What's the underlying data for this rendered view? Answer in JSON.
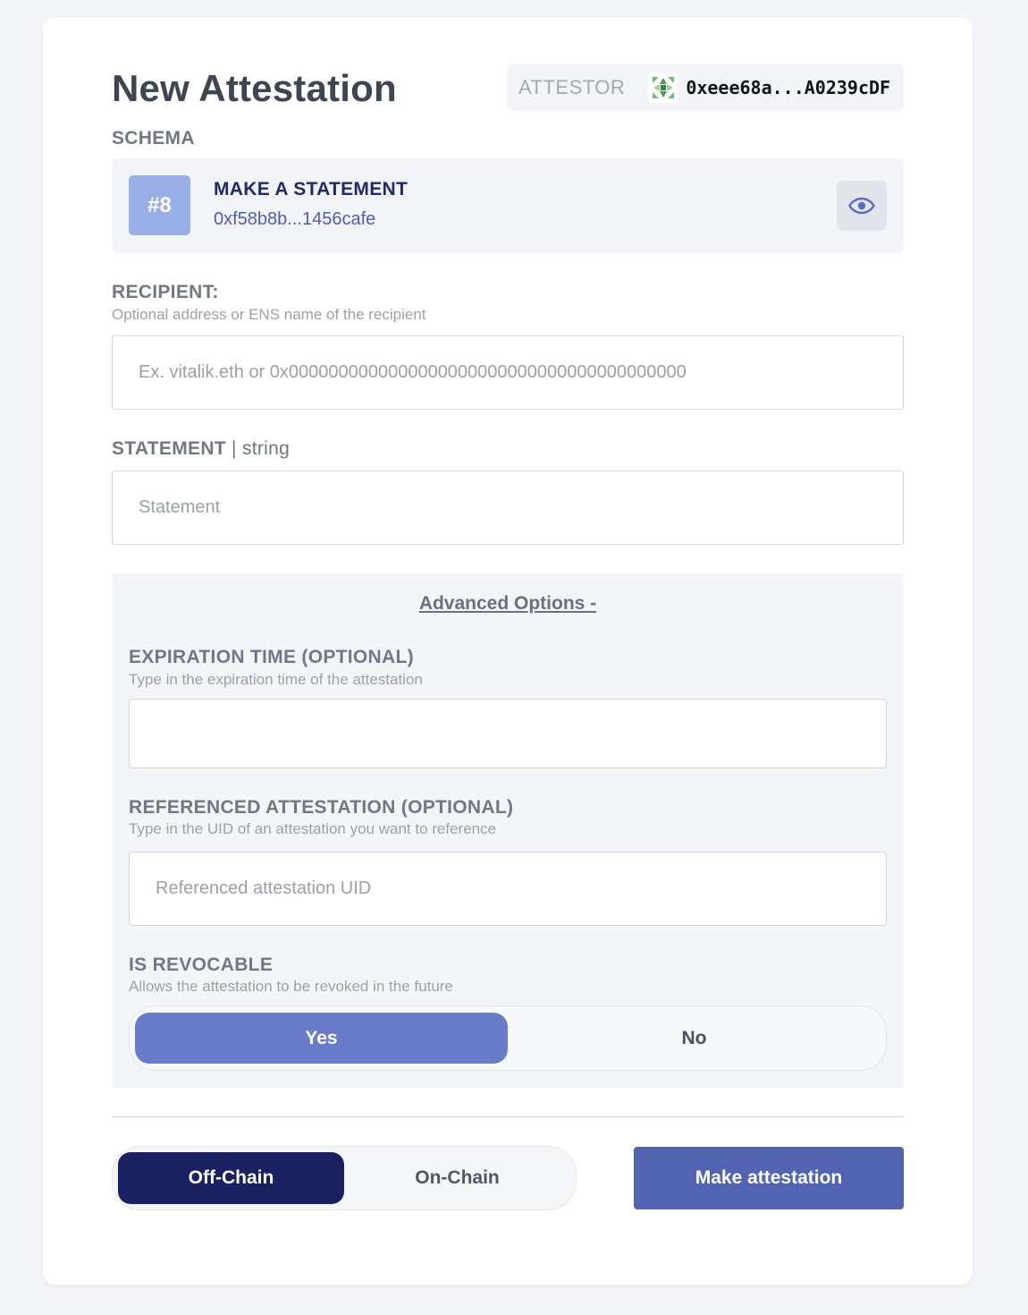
{
  "header": {
    "title": "New Attestation",
    "attestor_label": "ATTESTOR",
    "attestor_address": "0xeee68a...A0239cDF",
    "attestor_avatar_icon": "identicon-avatar"
  },
  "schema": {
    "label": "SCHEMA",
    "badge": "#8",
    "name": "MAKE A STATEMENT",
    "uid": "0xf58b8b...1456cafe",
    "view_icon": "eye-icon"
  },
  "recipient": {
    "label": "RECIPIENT:",
    "hint": "Optional address or ENS name of the recipient",
    "placeholder": "Ex. vitalik.eth or 0x0000000000000000000000000000000000000000",
    "value": ""
  },
  "statement": {
    "label": "STATEMENT",
    "type": " | string",
    "placeholder": "Statement",
    "value": ""
  },
  "advanced": {
    "toggle_label": "Advanced Options -",
    "expiration": {
      "label": "EXPIRATION TIME (OPTIONAL)",
      "hint": "Type in the expiration time of the attestation",
      "value": ""
    },
    "reference": {
      "label": "REFERENCED ATTESTATION (OPTIONAL)",
      "hint": "Type in the UID of an attestation you want to reference",
      "placeholder": "Referenced attestation UID",
      "value": ""
    },
    "revocable": {
      "label": "IS REVOCABLE",
      "hint": "Allows the attestation to be revoked in the future",
      "options": [
        "Yes",
        "No"
      ],
      "selected": "Yes"
    }
  },
  "footer": {
    "chain_options": [
      "Off-Chain",
      "On-Chain"
    ],
    "chain_selected": "Off-Chain",
    "submit_label": "Make attestation"
  },
  "colors": {
    "accent": "#5163b1",
    "selected_toggle": "#6a7bc8",
    "selected_chain": "#1a2160",
    "schema_badge": "#9aaee6"
  }
}
